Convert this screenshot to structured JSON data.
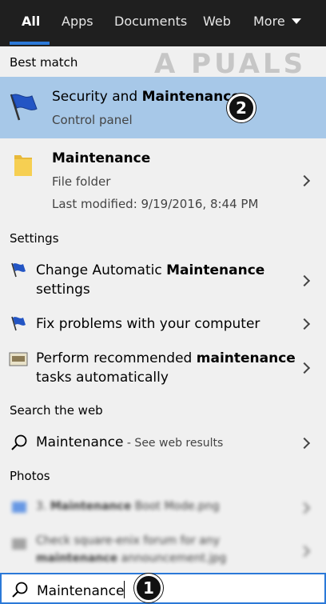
{
  "tabs": [
    {
      "label": "All",
      "active": true
    },
    {
      "label": "Apps"
    },
    {
      "label": "Documents"
    },
    {
      "label": "Web"
    },
    {
      "label": "More"
    }
  ],
  "watermark": "A PUALS",
  "sections": {
    "best_match": "Best match",
    "settings": "Settings",
    "search_web": "Search the web",
    "photos": "Photos"
  },
  "best_match": [
    {
      "title_pre": "Security and ",
      "title_bold": "Maintenance",
      "subtitle": "Control panel",
      "icon": "flag-icon",
      "selected": true
    },
    {
      "title_bold": "Maintenance",
      "subtitle": "File folder",
      "subtitle2": "Last modified: 9/19/2016, 8:44 PM",
      "icon": "folder-icon"
    }
  ],
  "settings": [
    {
      "line1_pre": "Change Automatic ",
      "line1_bold": "Maintenance",
      "line2": "settings",
      "icon": "flag-icon"
    },
    {
      "line1_pre": "Fix problems with your computer",
      "icon": "flag-icon"
    },
    {
      "line1_pre": "Perform recommended ",
      "line1_bold": "maintenance",
      "line2": "tasks automatically",
      "icon": "control-panel-icon"
    }
  ],
  "web_result": {
    "query": "Maintenance",
    "suffix": " - See web results",
    "icon": "search-icon"
  },
  "photos": [
    {
      "text_pre": "3. ",
      "text_bold": "Maintenance",
      "text_post": " Boot Mode.png"
    },
    {
      "line1": "Check square-enix forum for any",
      "line2_bold": "maintenance",
      "line2_post": " announcement.jpg"
    }
  ],
  "search": {
    "value": "Maintenance",
    "icon": "search-icon"
  },
  "badges": [
    "1",
    "2"
  ],
  "colors": {
    "accent": "#2b79d8",
    "selected_bg": "#a7c8e8",
    "tabbar_bg": "#1f1f1f"
  }
}
